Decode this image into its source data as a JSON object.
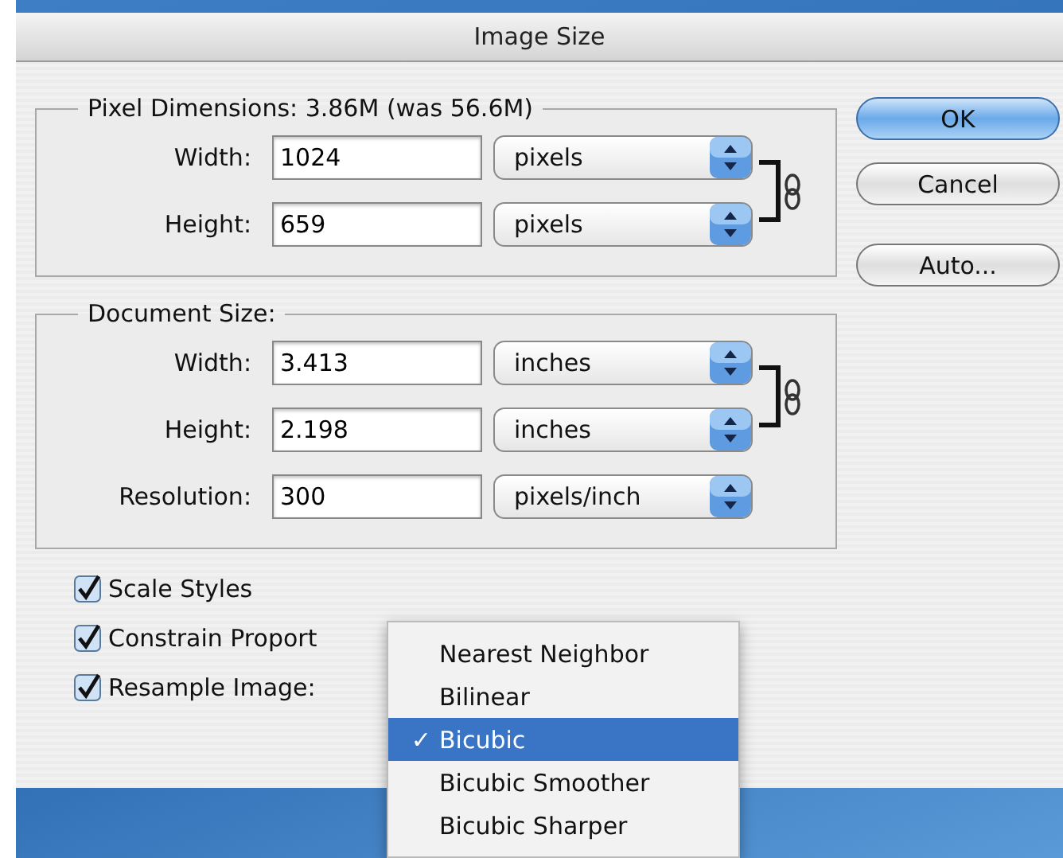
{
  "window": {
    "title": "Image Size"
  },
  "groups": [
    {
      "legend": "Pixel Dimensions:  3.86M (was 56.6M)",
      "rows": [
        {
          "label": "Width:",
          "value": "1024",
          "unit": "pixels",
          "linked": true
        },
        {
          "label": "Height:",
          "value": "659",
          "unit": "pixels",
          "linked": true
        }
      ]
    },
    {
      "legend": "Document Size:",
      "rows": [
        {
          "label": "Width:",
          "value": "3.413",
          "unit": "inches",
          "linked": true
        },
        {
          "label": "Height:",
          "value": "2.198",
          "unit": "inches",
          "linked": true
        },
        {
          "label": "Resolution:",
          "value": "300",
          "unit": "pixels/inch",
          "linked": false
        }
      ]
    }
  ],
  "buttons": [
    {
      "label": "OK",
      "default": true
    },
    {
      "label": "Cancel",
      "default": false
    },
    {
      "label": "Auto...",
      "default": false
    }
  ],
  "checkboxes": [
    {
      "label": "Scale Styles",
      "checked": true
    },
    {
      "label": "Constrain Proport",
      "checked": true
    },
    {
      "label": "Resample Image:",
      "checked": true
    }
  ],
  "resample_menu": {
    "check_mark": "✓",
    "items": [
      {
        "label": "Nearest Neighbor",
        "selected": false
      },
      {
        "label": "Bilinear",
        "selected": false
      },
      {
        "label": "Bicubic",
        "selected": true
      },
      {
        "label": "Bicubic Smoother",
        "selected": false
      },
      {
        "label": "Bicubic Sharper",
        "selected": false
      }
    ]
  }
}
